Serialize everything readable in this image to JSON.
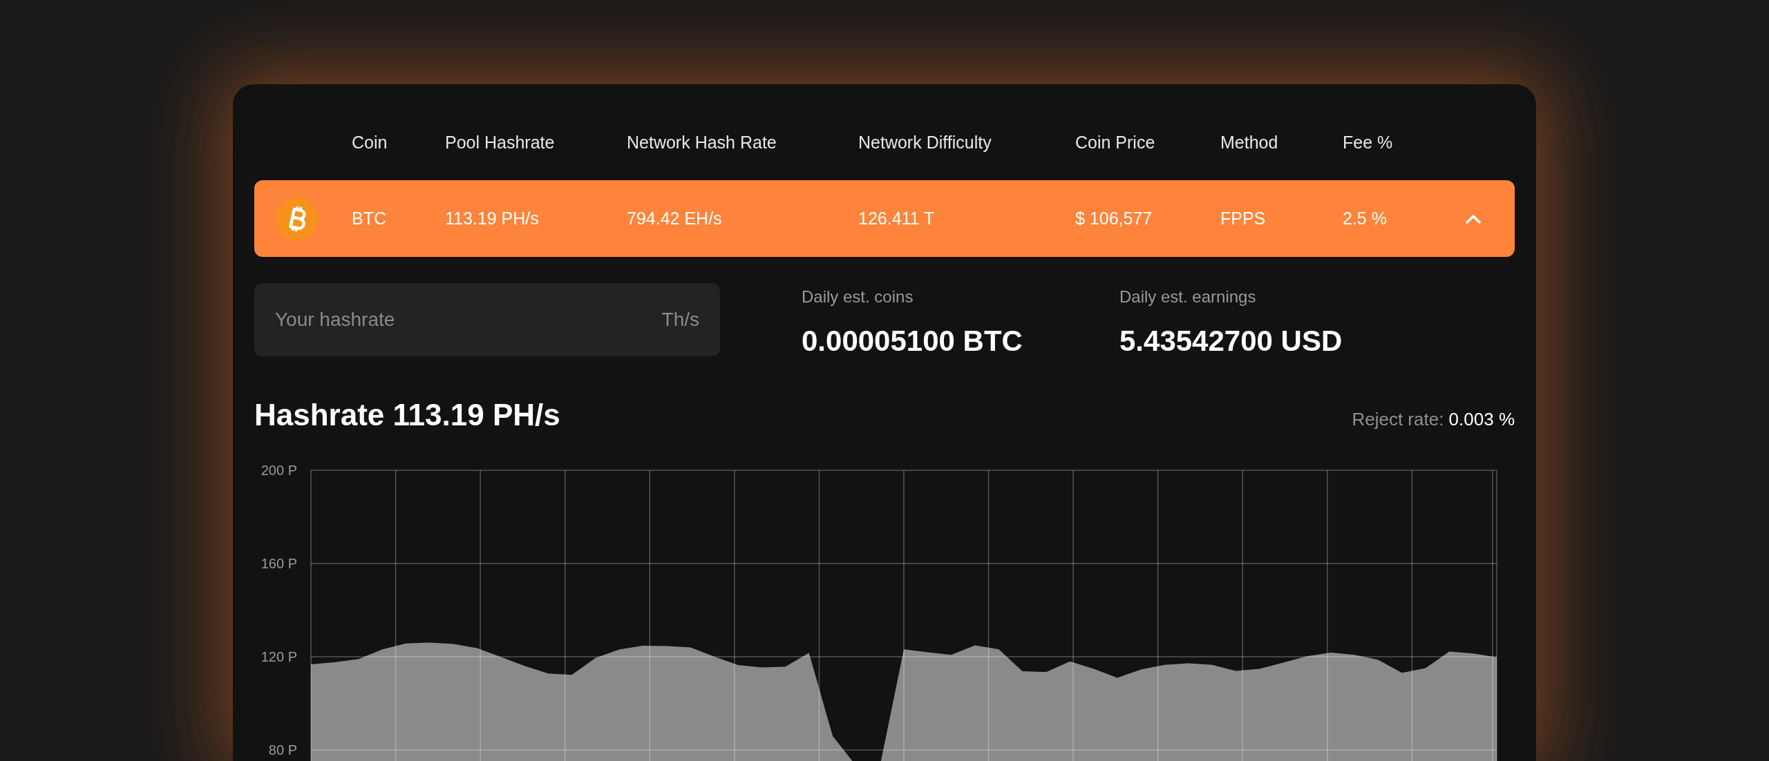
{
  "table": {
    "columns": [
      "Coin",
      "Pool Hashrate",
      "Network Hash Rate",
      "Network Difficulty",
      "Coin Price",
      "Method",
      "Fee %"
    ],
    "rows": [
      {
        "cells": [
          "BTC",
          "113.19 PH/s",
          "794.42 EH/s",
          "126.411 T",
          "$ 106,577",
          "FPPS",
          "2.5 %"
        ],
        "expanded": true
      }
    ]
  },
  "calculator": {
    "input": {
      "placeholder": "Your hashrate",
      "unit": "Th/s"
    },
    "stats": [
      {
        "label": "Daily est. coins",
        "value": "0.00005100 BTC"
      },
      {
        "label": "Daily est. earnings",
        "value": "5.43542700 USD"
      }
    ]
  },
  "hashrate": {
    "title": "Hashrate 113.19 PH/s",
    "reject_label": "Reject rate:",
    "reject_value": "0.003 %",
    "chart_data": {
      "type": "area",
      "categories": [
        null,
        null,
        null,
        null,
        null,
        null,
        null,
        null,
        null,
        null,
        null,
        null,
        null,
        null,
        null,
        null,
        null,
        null,
        null,
        null,
        null,
        null,
        null,
        null,
        null,
        null,
        null,
        null,
        null,
        null,
        null,
        null,
        null,
        null,
        null,
        null,
        null,
        null,
        null,
        null,
        null,
        null,
        null,
        null,
        null,
        null,
        null,
        null,
        null,
        null,
        null
      ],
      "series": [
        {
          "color": "#8a8a8a",
          "values": [
            116.7,
            117.6,
            119.0,
            123.1,
            125.7,
            126.1,
            125.5,
            123.7,
            119.9,
            116.1,
            112.8,
            112.2,
            119.5,
            123.1,
            124.7,
            124.6,
            124.0,
            120.1,
            116.4,
            115.4,
            115.7,
            121.6,
            86,
            73,
            73.5,
            123.2,
            121.9,
            120.8,
            124.9,
            123.2,
            113.8,
            113.4,
            118.0,
            114.8,
            111.0,
            114.5,
            116.5,
            117.2,
            116.5,
            113.9,
            114.8,
            117.5,
            120.2,
            121.8,
            120.8,
            118.7,
            113.1,
            115.1,
            122.2,
            121.4,
            119.8
          ]
        }
      ],
      "ylim": [
        73,
        200
      ],
      "grid": true,
      "yticks": [
        {
          "value": 200,
          "label": "200 P"
        },
        {
          "value": 160,
          "label": "160 P"
        },
        {
          "value": 120,
          "label": "120 P"
        },
        {
          "value": 80,
          "label": "80 P"
        }
      ]
    }
  }
}
